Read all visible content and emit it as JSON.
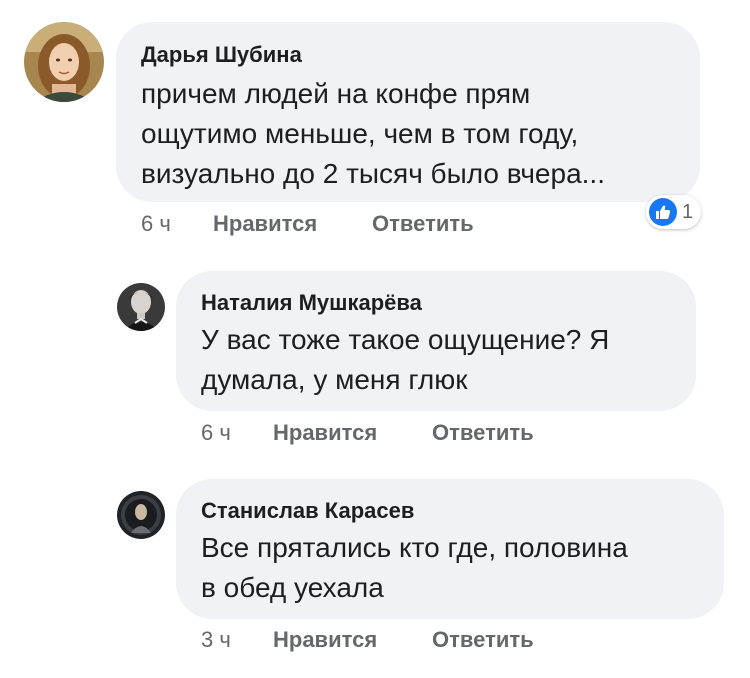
{
  "comments": [
    {
      "author": "Дарья Шубина",
      "lines": [
        "причем людей на конфе прям",
        "ощутимо меньше, чем в том году,",
        "визуально до 2 тысяч было вчера..."
      ],
      "time": "6 ч",
      "like_label": "Нравится",
      "reply_label": "Ответить",
      "reaction_icon": "like-icon",
      "reaction_count": "1"
    },
    {
      "author": "Наталия Мушкарёва",
      "lines": [
        "У вас тоже такое ощущение? Я",
        "думала, у меня глюк"
      ],
      "time": "6 ч",
      "like_label": "Нравится",
      "reply_label": "Ответить"
    },
    {
      "author": "Станислав Карасев",
      "lines": [
        "Все прятались кто где, половина",
        "в обед уехала"
      ],
      "time": "3 ч",
      "like_label": "Нравится",
      "reply_label": "Ответить"
    }
  ],
  "colors": {
    "bubble": "#f0f2f5",
    "meta_text": "#65676b",
    "like_blue": "#1877f2"
  }
}
